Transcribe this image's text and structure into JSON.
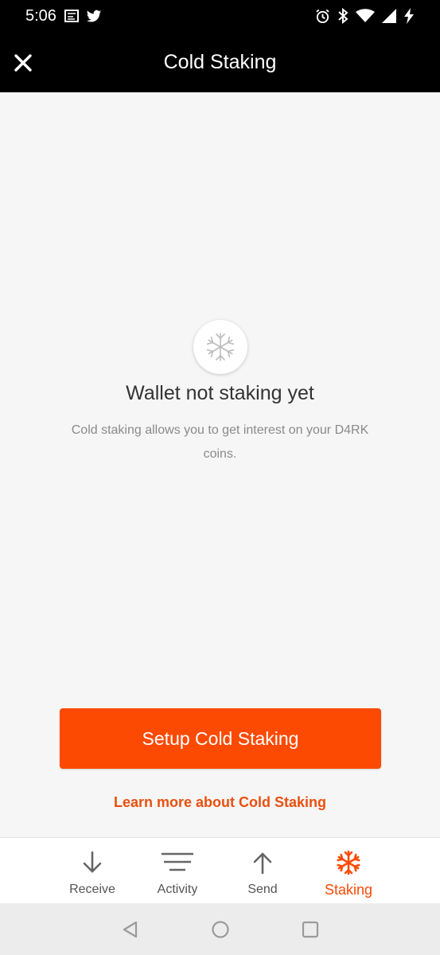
{
  "status_bar": {
    "time": "5:06",
    "left_icons": [
      "notification-app-icon",
      "twitter-icon"
    ],
    "right_icons": [
      "alarm-icon",
      "bluetooth-icon",
      "wifi-icon",
      "signal-icon",
      "charging-icon"
    ]
  },
  "app_bar": {
    "title": "Cold Staking",
    "close_icon": "close-icon"
  },
  "empty_state": {
    "icon": "snowflake-icon",
    "title": "Wallet not staking yet",
    "description": "Cold staking allows you to get interest on your D4RK coins."
  },
  "actions": {
    "setup_label": "Setup Cold Staking",
    "learn_more_label": "Learn more about Cold Staking"
  },
  "bottom_nav": {
    "items": [
      {
        "label": "Receive",
        "icon": "arrow-down-icon",
        "active": false
      },
      {
        "label": "Activity",
        "icon": "lines-icon",
        "active": false
      },
      {
        "label": "Send",
        "icon": "arrow-up-icon",
        "active": false
      },
      {
        "label": "Staking",
        "icon": "snowflake-icon",
        "active": true
      }
    ]
  },
  "system_nav": {
    "buttons": [
      "back-icon",
      "home-icon",
      "recents-icon"
    ]
  },
  "colors": {
    "accent": "#fc4a03",
    "header_bg": "#000000",
    "page_bg": "#f6f6f6",
    "nav_active": "#fc4a03"
  }
}
